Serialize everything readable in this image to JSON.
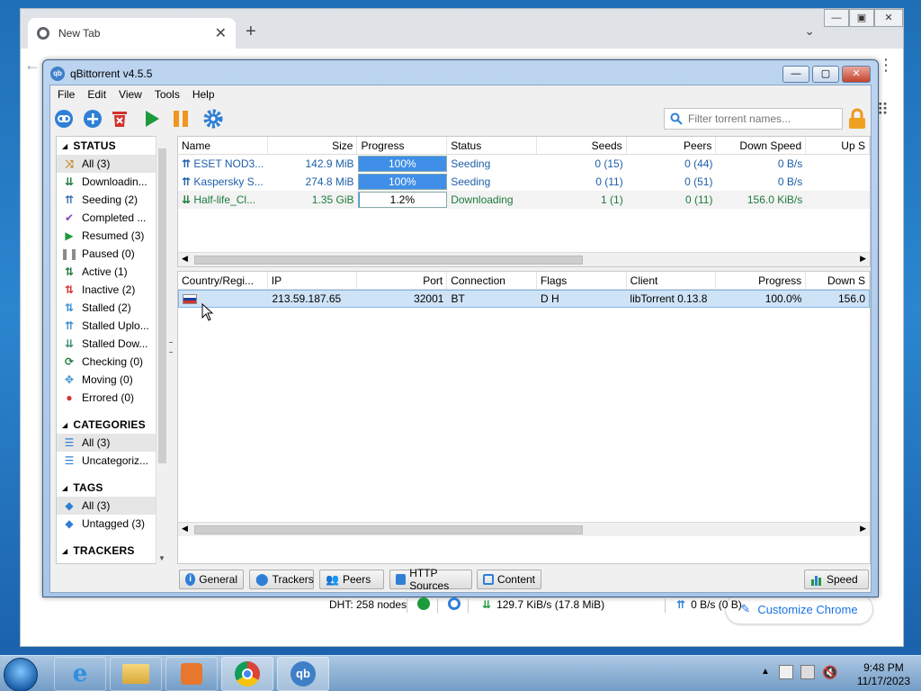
{
  "chrome": {
    "tab_title": "New Tab",
    "customize_label": "Customize Chrome"
  },
  "app": {
    "title": "qBittorrent v4.5.5",
    "menu": [
      "File",
      "Edit",
      "View",
      "Tools",
      "Help"
    ],
    "search_placeholder": "Filter torrent names..."
  },
  "sidebar": {
    "status_header": "STATUS",
    "status_items": [
      {
        "label": "All (3)",
        "icon": "shuffle-icon",
        "color": "#c9882b",
        "selected": true
      },
      {
        "label": "Downloadin...",
        "icon": "download-icon",
        "color": "#1d7a3c"
      },
      {
        "label": "Seeding (2)",
        "icon": "upload-icon",
        "color": "#3a6fb5"
      },
      {
        "label": "Completed ...",
        "icon": "check-icon",
        "color": "#8a3fb5"
      },
      {
        "label": "Resumed (3)",
        "icon": "play-icon",
        "color": "#1d9a3c"
      },
      {
        "label": "Paused (0)",
        "icon": "pause-icon",
        "color": "#8a8a8a"
      },
      {
        "label": "Active (1)",
        "icon": "active-icon",
        "color": "#1d7a3c"
      },
      {
        "label": "Inactive (2)",
        "icon": "inactive-icon",
        "color": "#d2322d"
      },
      {
        "label": "Stalled (2)",
        "icon": "stalled-icon",
        "color": "#3a8fd0"
      },
      {
        "label": "Stalled Uplo...",
        "icon": "stalled-upload-icon",
        "color": "#3a8fd0"
      },
      {
        "label": "Stalled Dow...",
        "icon": "stalled-download-icon",
        "color": "#3a8f6c"
      },
      {
        "label": "Checking (0)",
        "icon": "checking-icon",
        "color": "#1d7a3c"
      },
      {
        "label": "Moving (0)",
        "icon": "moving-icon",
        "color": "#3a8fd0"
      },
      {
        "label": "Errored (0)",
        "icon": "error-icon",
        "color": "#d2322d"
      }
    ],
    "categories_header": "CATEGORIES",
    "category_items": [
      {
        "label": "All (3)",
        "selected": true
      },
      {
        "label": "Uncategoriz..."
      }
    ],
    "tags_header": "TAGS",
    "tag_items": [
      {
        "label": "All (3)",
        "selected": true
      },
      {
        "label": "Untagged (3)"
      }
    ],
    "trackers_header": "TRACKERS"
  },
  "torrents": {
    "columns": [
      "Name",
      "Size",
      "Progress",
      "Status",
      "Seeds",
      "Peers",
      "Down Speed",
      "Up S"
    ],
    "rows": [
      {
        "name": "ESET NOD3...",
        "size": "142.9 MiB",
        "progress": "100%",
        "progress_value": 1.0,
        "status": "Seeding",
        "seeds": "0 (15)",
        "peers": "0 (44)",
        "down": "0 B/s",
        "kind": "seeding"
      },
      {
        "name": "Kaspersky S...",
        "size": "274.8 MiB",
        "progress": "100%",
        "progress_value": 1.0,
        "status": "Seeding",
        "seeds": "0 (11)",
        "peers": "0 (51)",
        "down": "0 B/s",
        "kind": "seeding"
      },
      {
        "name": "Half-life_Cl...",
        "size": "1.35 GiB",
        "progress": "1.2%",
        "progress_value": 0.012,
        "status": "Downloading",
        "seeds": "1 (1)",
        "peers": "0 (11)",
        "down": "156.0 KiB/s",
        "kind": "downloading"
      }
    ]
  },
  "peers": {
    "columns": [
      "Country/Regi...",
      "IP",
      "Port",
      "Connection",
      "Flags",
      "Client",
      "Progress",
      "Down S"
    ],
    "rows": [
      {
        "ip": "213.59.187.65",
        "port": "32001",
        "connection": "BT",
        "flags": "D H",
        "client": "libTorrent 0.13.8",
        "progress": "100.0%",
        "down": "156.0"
      }
    ]
  },
  "bottom_tabs": [
    "General",
    "Trackers",
    "Peers",
    "HTTP Sources",
    "Content"
  ],
  "speed_button": "Speed",
  "statusbar": {
    "dht": "DHT: 258 nodes",
    "download": "129.7 KiB/s (17.8 MiB)",
    "upload": "0 B/s (0 B)"
  },
  "taskbar": {
    "time": "9:48 PM",
    "date": "11/17/2023"
  }
}
